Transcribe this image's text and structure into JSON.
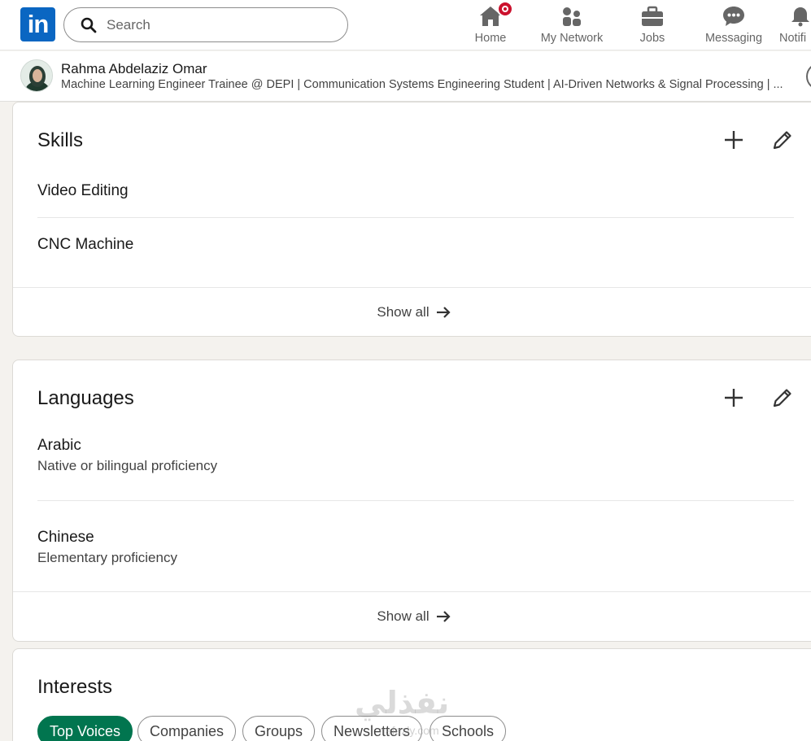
{
  "nav": {
    "logo": "in",
    "search_placeholder": "Search",
    "items": [
      {
        "label": "Home"
      },
      {
        "label": "My Network"
      },
      {
        "label": "Jobs"
      },
      {
        "label": "Messaging"
      },
      {
        "label": "Notifi"
      }
    ]
  },
  "profile": {
    "name": "Rahma Abdelaziz Omar",
    "headline": "Machine Learning Engineer Trainee @ DEPI | Communication Systems Engineering Student | AI-Driven Networks & Signal Processing | ..."
  },
  "skills": {
    "title": "Skills",
    "items": [
      {
        "name": "Video Editing"
      },
      {
        "name": "CNC Machine"
      }
    ],
    "show_all": "Show all"
  },
  "languages": {
    "title": "Languages",
    "items": [
      {
        "name": "Arabic",
        "proficiency": "Native or bilingual proficiency"
      },
      {
        "name": "Chinese",
        "proficiency": "Elementary proficiency"
      }
    ],
    "show_all": "Show all"
  },
  "interests": {
    "title": "Interests",
    "tabs": [
      "Top Voices",
      "Companies",
      "Groups",
      "Newsletters",
      "Schools"
    ],
    "active_tab": "Top Voices"
  },
  "watermark": {
    "text": "نفذلي",
    "subtext": "nafezly.com"
  },
  "colors": {
    "linkedin_blue": "#0a66c2",
    "active_green": "#01754f",
    "notification_red": "#cb112d"
  }
}
